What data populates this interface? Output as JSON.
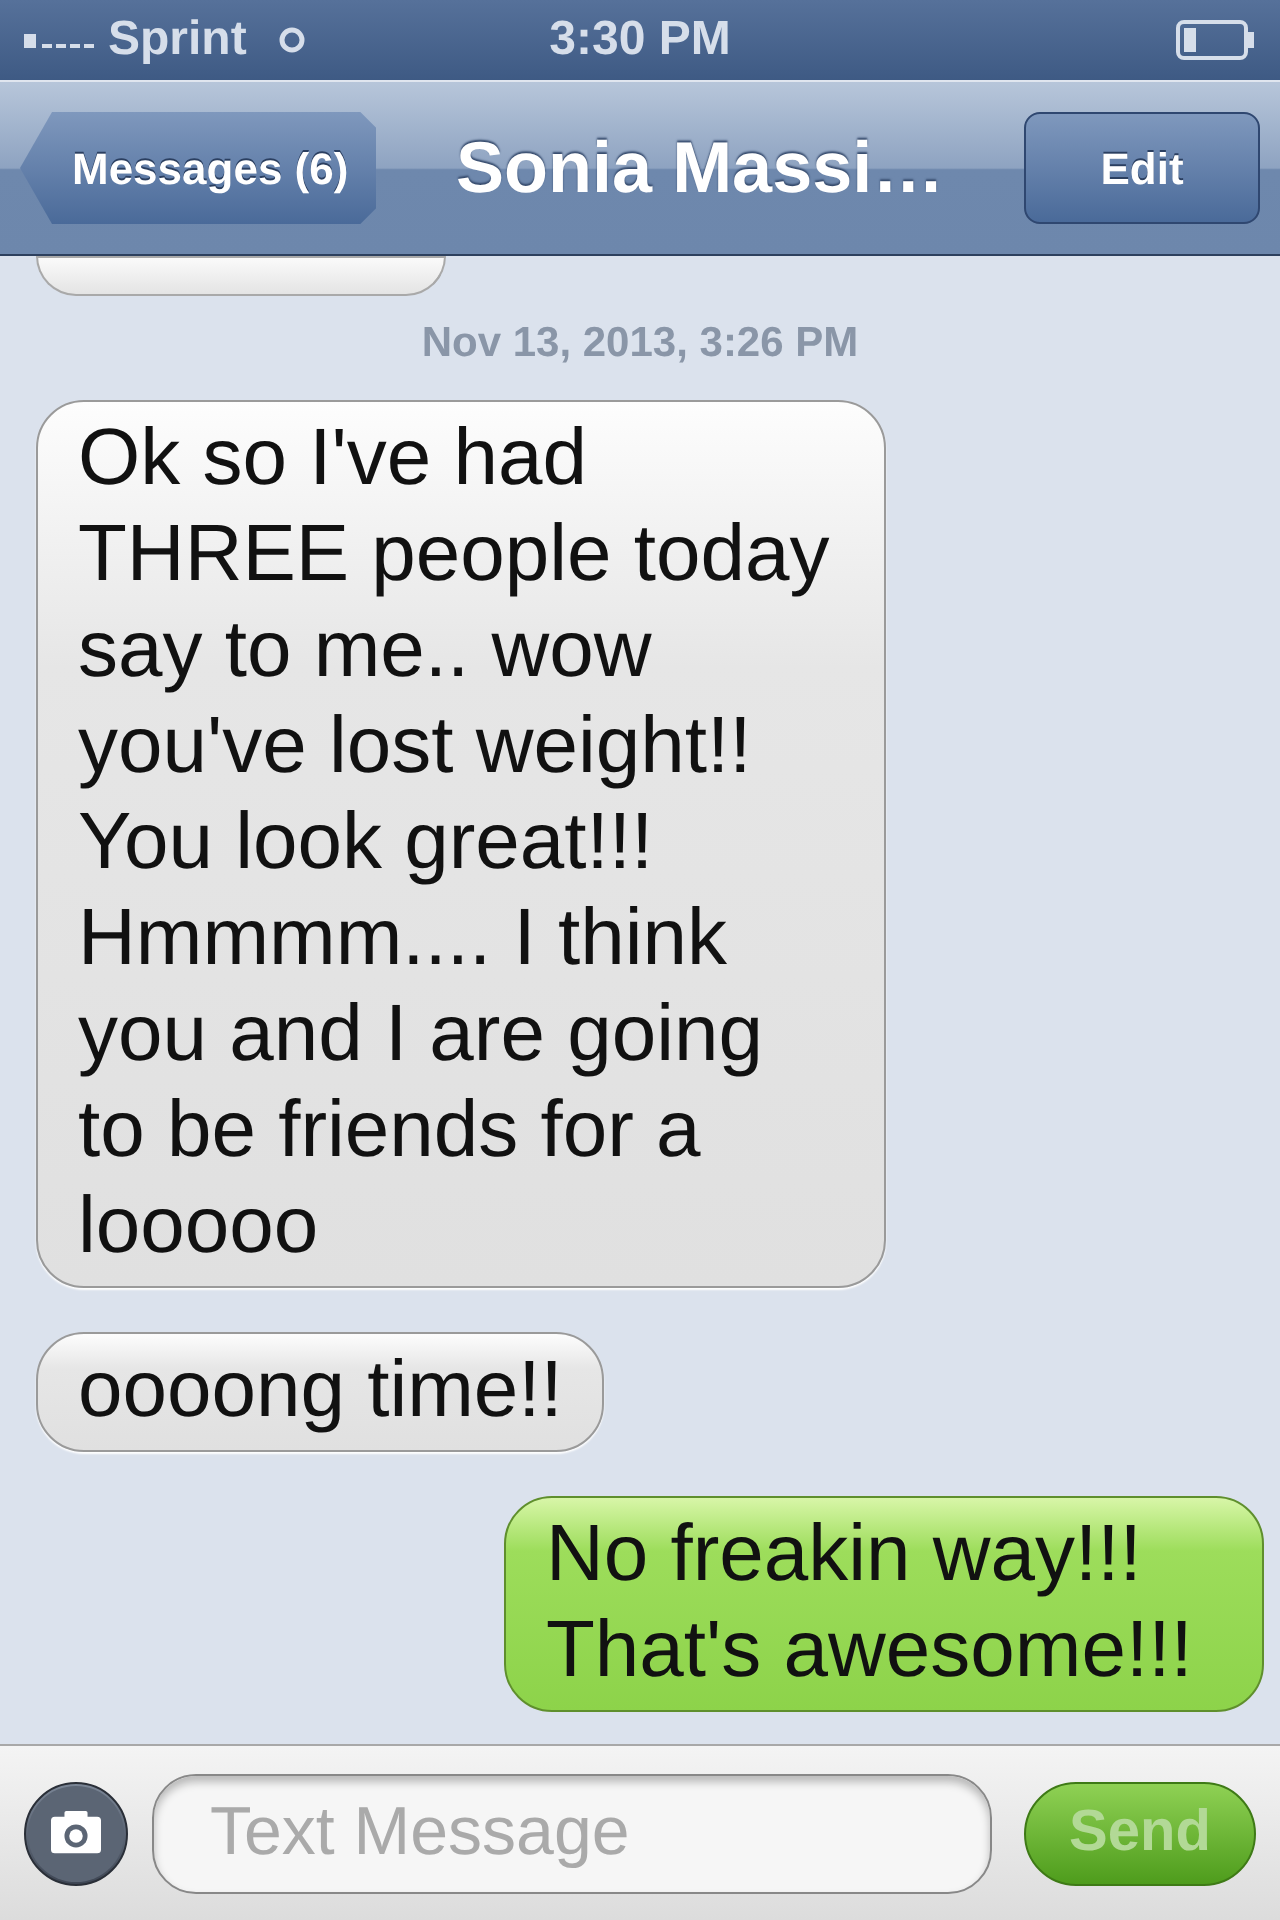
{
  "status_bar": {
    "carrier": "Sprint",
    "time": "3:30 PM"
  },
  "nav": {
    "back": "Messages (6)",
    "title": "Sonia Massi…",
    "edit": "Edit"
  },
  "messages": [
    {
      "kind": "clipped"
    },
    {
      "kind": "timestamp",
      "text": "Nov 13, 2013, 3:26 PM"
    },
    {
      "kind": "received",
      "text": "Ok so I've had THREE people today say to me.. wow you've lost weight!! You look great!!! Hmmmm.... I think you and I are going to be friends for a looooo"
    },
    {
      "kind": "received",
      "text": "oooong time!!"
    },
    {
      "kind": "sent",
      "text": "No freakin way!!! That's awesome!!!"
    }
  ],
  "composer": {
    "placeholder": "Text Message",
    "send": "Send",
    "send_disabled": true
  }
}
